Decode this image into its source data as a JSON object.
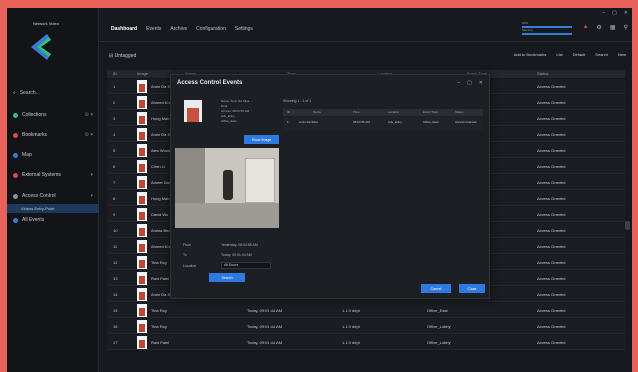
{
  "sidebar": {
    "logo_text": "Network Video",
    "search_label": "Search...",
    "items": [
      {
        "label": "Collections",
        "color": "#2ec27e"
      },
      {
        "label": "Bookmarks",
        "color": "#e04848"
      },
      {
        "label": "Map",
        "color": "#3a7bd5"
      },
      {
        "label": "External Systems",
        "color": "#e04848"
      },
      {
        "label": "Access Control",
        "color": "#8a939b"
      },
      {
        "label": "All Events",
        "color": "#3a7bd5"
      }
    ],
    "subitem": "Videos-Entry-Point"
  },
  "topbar": {
    "tabs": [
      "Dashboard",
      "Events",
      "Archive",
      "Configuration",
      "Settings"
    ],
    "status_cpu": "CPU",
    "status_mem": "Memory"
  },
  "toolbar": {
    "title": "Untagged",
    "add_label": "Add to Bookmarks",
    "list_label": "List",
    "default_label": "Default",
    "search_label": "Search",
    "new_label": "New"
  },
  "table": {
    "headers": [
      "ID",
      "Image",
      "Name",
      "Time",
      "Location",
      "Event Type",
      "Status"
    ],
    "rows": [
      {
        "id": "1",
        "name": "Amin Da Silva",
        "time": "",
        "loc": "",
        "type": "",
        "status": "Access Granted"
      },
      {
        "id": "2",
        "name": "Ahmed Khan",
        "time": "",
        "loc": "",
        "type": "",
        "status": "Access Granted"
      },
      {
        "id": "3",
        "name": "Hung Mah",
        "time": "",
        "loc": "",
        "type": "",
        "status": "Access Granted"
      },
      {
        "id": "4",
        "name": "Amin Da Silva",
        "time": "",
        "loc": "",
        "type": "",
        "status": "Access Granted"
      },
      {
        "id": "5",
        "name": "Alex Wood",
        "time": "",
        "loc": "",
        "type": "",
        "status": "Access Granted"
      },
      {
        "id": "6",
        "name": "Chen Li",
        "time": "",
        "loc": "",
        "type": "",
        "status": "Access Granted"
      },
      {
        "id": "7",
        "name": "Ameer Sami",
        "time": "",
        "loc": "",
        "type": "",
        "status": "Access Granted"
      },
      {
        "id": "8",
        "name": "Hung Mah",
        "time": "",
        "loc": "",
        "type": "",
        "status": "Access Granted"
      },
      {
        "id": "9",
        "name": "David Wu",
        "time": "",
        "loc": "",
        "type": "",
        "status": "Access Granted"
      },
      {
        "id": "10",
        "name": "Amina Beck",
        "time": "",
        "loc": "",
        "type": "",
        "status": "Access Granted"
      },
      {
        "id": "11",
        "name": "Ahmed Khan",
        "time": "",
        "loc": "",
        "type": "",
        "status": "Access Granted"
      },
      {
        "id": "12",
        "name": "Tina Roy",
        "time": "",
        "loc": "",
        "type": "",
        "status": "Access Granted"
      },
      {
        "id": "13",
        "name": "Ravi Patel",
        "time": "",
        "loc": "",
        "type": "",
        "status": "Access Granted"
      },
      {
        "id": "14",
        "name": "Amin Da Silva",
        "time": "Today, 09:01:44 AM",
        "loc": "1.1.0 dept",
        "type": "Office_East",
        "status": "Access Granted"
      },
      {
        "id": "15",
        "name": "Tina Roy",
        "time": "Today, 09:01:44 AM",
        "loc": "1.1.0 dept",
        "type": "Office_East",
        "status": "Access Granted"
      },
      {
        "id": "16",
        "name": "Tina Roy",
        "time": "Today, 09:01:44 AM",
        "loc": "1.1.0 dept",
        "type": "Office_Lobby",
        "status": "Access Granted"
      },
      {
        "id": "17",
        "name": "Ravi Patel",
        "time": "Today, 09:01:44 AM",
        "loc": "1.1.0 dept",
        "type": "Office_Lobby",
        "status": "Access Granted"
      }
    ]
  },
  "modal": {
    "title": "Access Control Events",
    "person_info": [
      "Name: Amin Da Silva",
      "Dept",
      "Access: 08:04:55 AM",
      "Adv_Entry",
      "Office_East"
    ],
    "show_image_btn": "Show Image",
    "summary": "Showing 1 - 1 of 1",
    "evt_headers": [
      "ID",
      "Name",
      "Time",
      "Location",
      "Event Type",
      "Status"
    ],
    "evt_row": {
      "id": "1",
      "name": "Amin Da Silva",
      "time": "08:04:55 AM",
      "loc": "Adv_Entry",
      "type": "Office_East",
      "status": "Access Granted"
    },
    "form_from_label": "From",
    "form_from_value": "Yesterday, 08:04:55 AM",
    "form_to_label": "To",
    "form_to_value": "Today, 09:01:44 AM",
    "form_loc_label": "Location",
    "form_loc_value": "All Doors",
    "search_btn": "Search",
    "cancel_btn": "Cancel",
    "ok_btn": "Close"
  }
}
